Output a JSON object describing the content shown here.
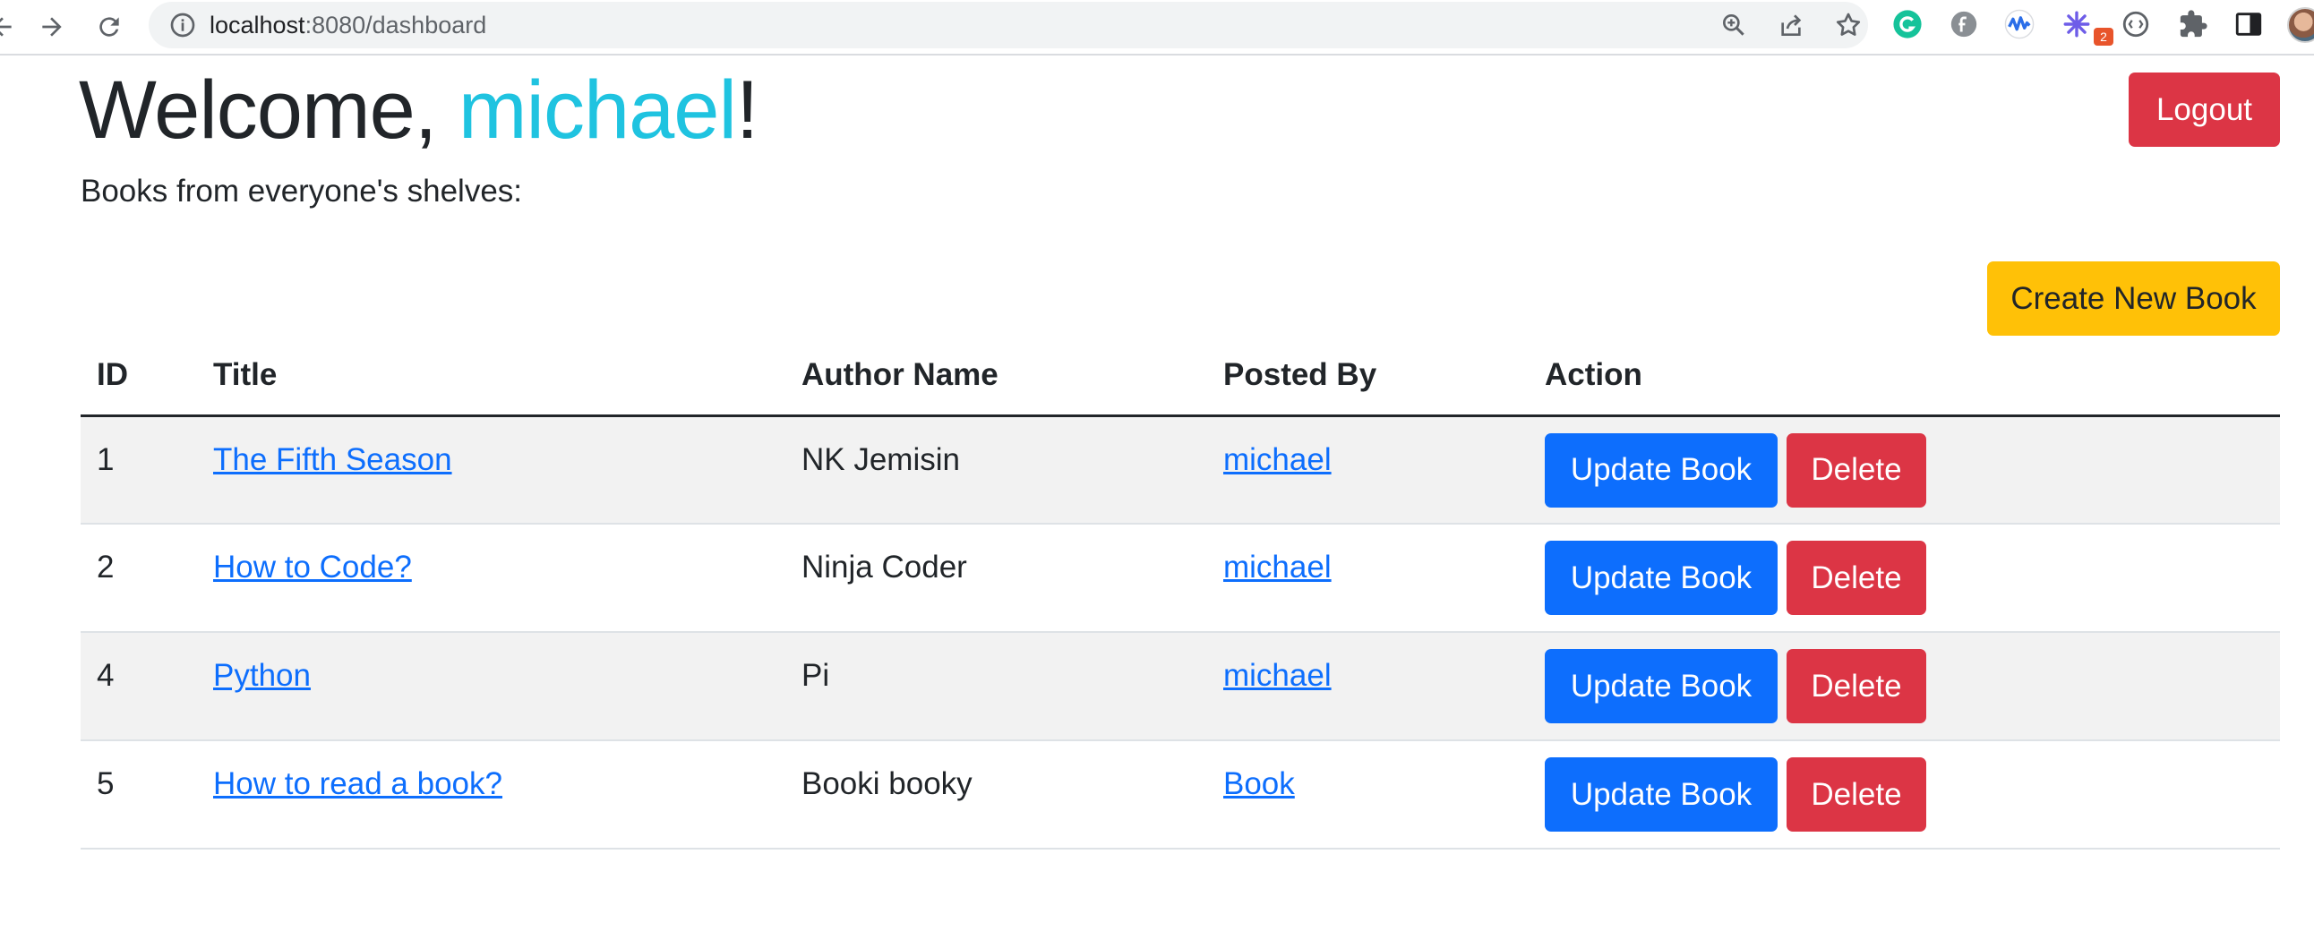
{
  "browser": {
    "url_host": "localhost",
    "url_path": ":8080/dashboard",
    "extension_badge": "2"
  },
  "header": {
    "welcome_prefix": "Welcome, ",
    "username": "michael",
    "welcome_suffix": "!",
    "subtitle": "Books from everyone's shelves:",
    "logout_label": "Logout",
    "create_label": "Create New Book"
  },
  "table": {
    "headers": [
      "ID",
      "Title",
      "Author Name",
      "Posted By",
      "Action"
    ],
    "rows": [
      {
        "id": "1",
        "title": "The Fifth Season",
        "author": "NK Jemisin",
        "posted_by": "michael"
      },
      {
        "id": "2",
        "title": "How to Code?",
        "author": "Ninja Coder",
        "posted_by": "michael"
      },
      {
        "id": "4",
        "title": "Python",
        "author": "Pi",
        "posted_by": "michael"
      },
      {
        "id": "5",
        "title": "How to read a book?",
        "author": "Booki booky",
        "posted_by": "Book"
      }
    ],
    "update_label": "Update Book",
    "delete_label": "Delete"
  },
  "colors": {
    "username": "#1fc3e0",
    "danger": "#dc3545",
    "primary": "#0d6efd",
    "warning": "#ffc107",
    "link": "#0d6efd"
  },
  "icons": [
    "back-icon",
    "forward-icon",
    "reload-icon",
    "info-icon",
    "zoom-icon",
    "share-icon",
    "bookmark-star-icon",
    "grammarly-icon",
    "extension-icon",
    "extensions-puzzle-icon",
    "side-panel-icon"
  ]
}
